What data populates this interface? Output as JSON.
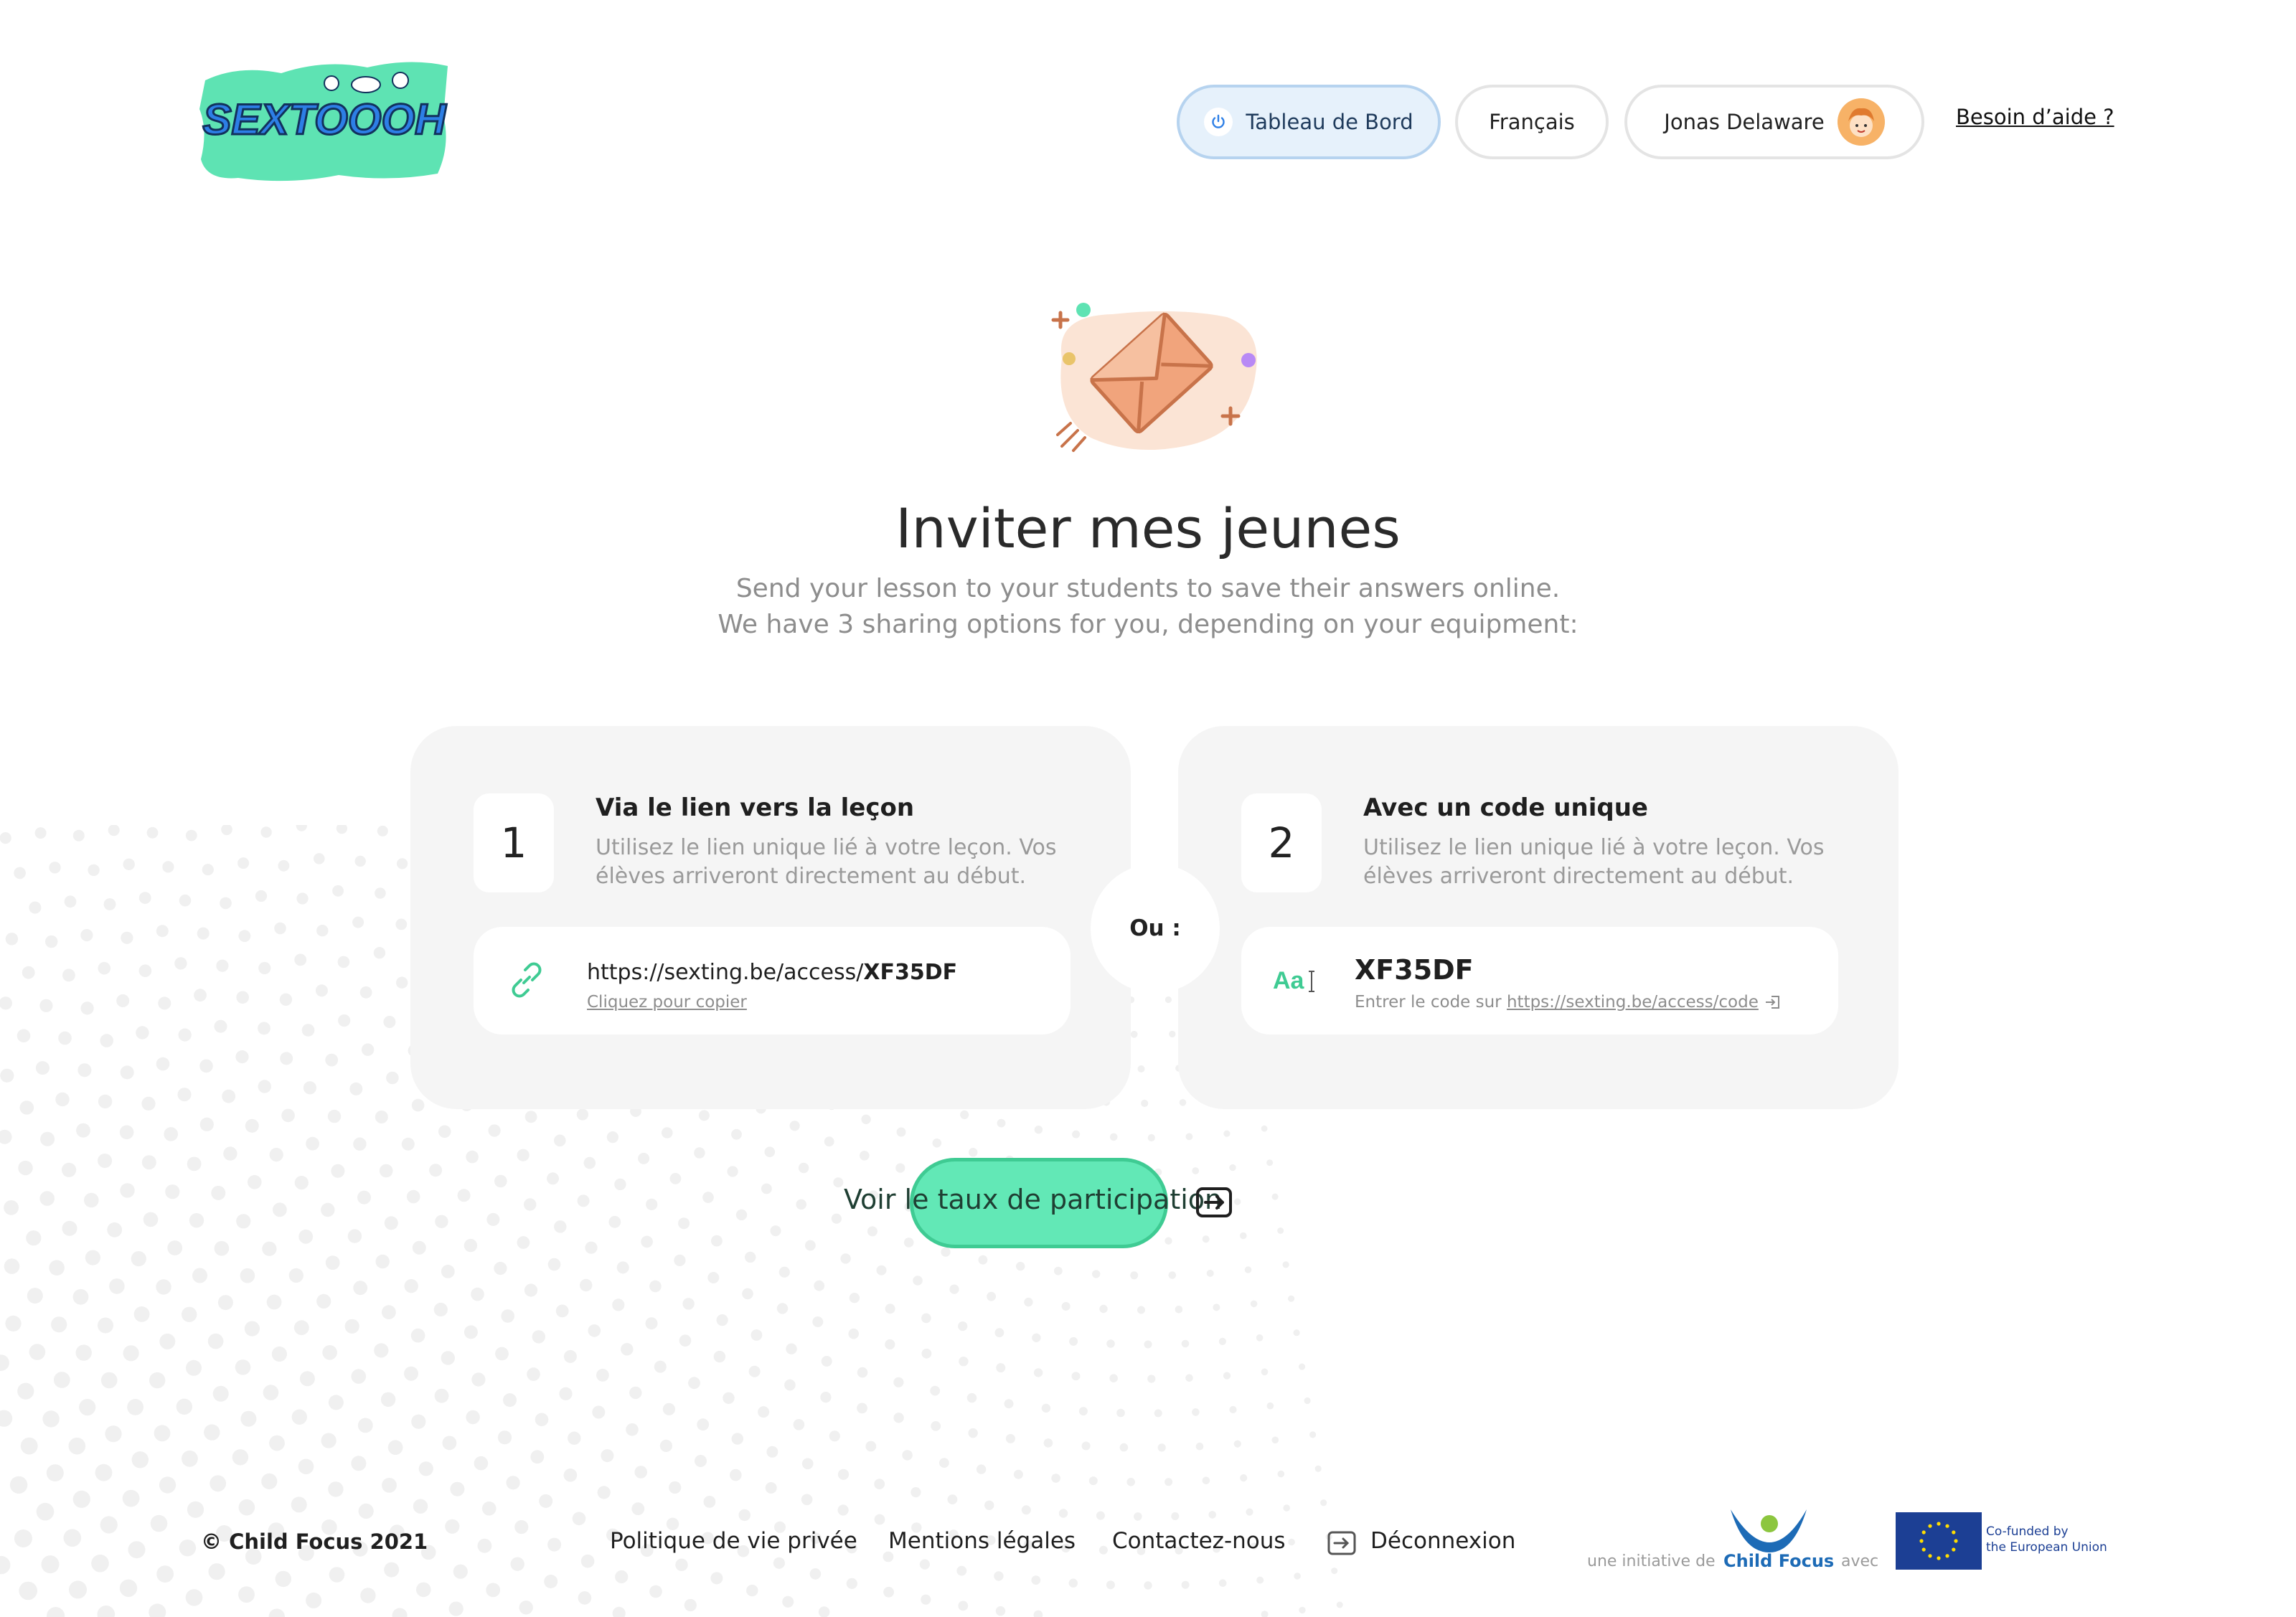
{
  "header": {
    "logo_text": "SEXTOOOH",
    "dashboard_label": "Tableau de Bord",
    "language_label": "Français",
    "user_name": "Jonas Delaware",
    "help_link": "Besoin d’aide ?"
  },
  "hero": {
    "title": "Inviter mes jeunes",
    "subtitle_line1": "Send your lesson to your students to save their answers online.",
    "subtitle_line2": "We have 3 sharing options for you, depending on your equipment:"
  },
  "options": [
    {
      "number": "1",
      "title": "Via le lien vers la leçon",
      "description": "Utilisez le lien unique lié à votre leçon. Vos élèves arriveront directement au début.",
      "link_prefix": "https://sexting.be/access/",
      "link_code": "XF35DF",
      "copy_label": "Cliquez pour copier"
    },
    {
      "number": "2",
      "title": "Avec un code unique",
      "description": "Utilisez le lien unique lié à votre leçon. Vos élèves arriveront directement au début.",
      "code": "XF35DF",
      "code_hint_prefix": "Entrer le code sur",
      "code_hint_link": "https://sexting.be/access/code"
    }
  ],
  "separator_label": "Ou :",
  "participation_button": "Voir le taux de participation",
  "footer": {
    "copyright": "© Child Focus 2021",
    "links": [
      "Politique de vie privée",
      "Mentions légales",
      "Contactez-nous",
      "Déconnexion"
    ],
    "initiative_label": "une initiative de",
    "child_focus_name": "Child Focus",
    "with_label": "avec",
    "eu_text_line1": "Co-funded by",
    "eu_text_line2": "the European Union"
  },
  "colors": {
    "accent_green": "#62e8b6",
    "dashboard_pill_bg": "#e6f1fb",
    "card_bg": "#f5f5f5",
    "envelope_orange": "#c8734a",
    "eu_blue": "#1c3f94",
    "child_focus_blue": "#1d6bb6"
  },
  "icons": [
    "power-icon",
    "avatar",
    "envelope-illustration",
    "link-icon",
    "text-code-icon",
    "external-link-icon",
    "logout-icon"
  ]
}
